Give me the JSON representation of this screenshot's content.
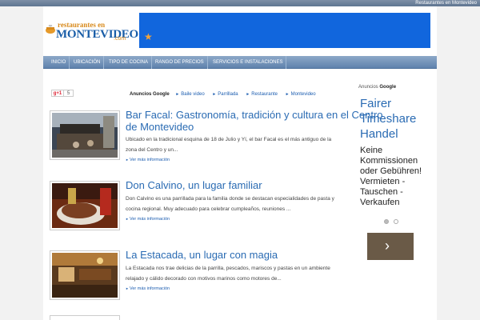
{
  "topbar": {
    "link": "Restaurantes en Montevideo"
  },
  "logo": {
    "small": "restaurantes en",
    "big": "MONTEVIDEO",
    "com": ".com"
  },
  "nav": [
    {
      "label": "Inicio"
    },
    {
      "label": "Ubicación"
    },
    {
      "label": "Tipo de cocina"
    },
    {
      "label": "Rango de precios"
    },
    {
      "label": "Servicios e instalaciones"
    }
  ],
  "social": {
    "gplus": "g+1",
    "count": "5"
  },
  "adlinks": {
    "title": "Anuncios Google",
    "links": [
      "Baile video",
      "Parrillada",
      "Restaurante",
      "Montevideo"
    ]
  },
  "articles": [
    {
      "title": "Bar Facal: Gastronomía, tradición y cultura en el Centro de Montevideo",
      "text": "Ubicado en la tradicional esquina de 18 de Julio y Yí, el bar Facal es el más antiguo de la zona del Centro y un...",
      "more": "Ver más información"
    },
    {
      "title": "Don Calvino, un lugar familiar",
      "text": "Don Calvino es una parrillada para la familia donde se destacan especialidades de pasta y cocina regional. Muy adecuado para celebrar cumpleaños, reuniones ...",
      "more": "Ver más información"
    },
    {
      "title": "La Estacada, un lugar con magia",
      "text": "La Estacada nos trae delicias de la parrilla, pescados, mariscos y pastas en un ambiente relajado y cálido decorado con motivos marinos como motores de...",
      "more": "Ver más información"
    }
  ],
  "sidebar": {
    "ads_prefix": "Anuncios",
    "ads_brand": "Google",
    "title": "Fairer Timeshare Handel",
    "text": "Keine Kommissionen oder Gebühren! Vermieten - Tauschen - Verkaufen",
    "next_arrow": "›"
  },
  "colors": {
    "accent": "#2a6bb3",
    "nav": "#6f8fb7",
    "banner": "#1166dd",
    "button": "#6a5a47"
  }
}
